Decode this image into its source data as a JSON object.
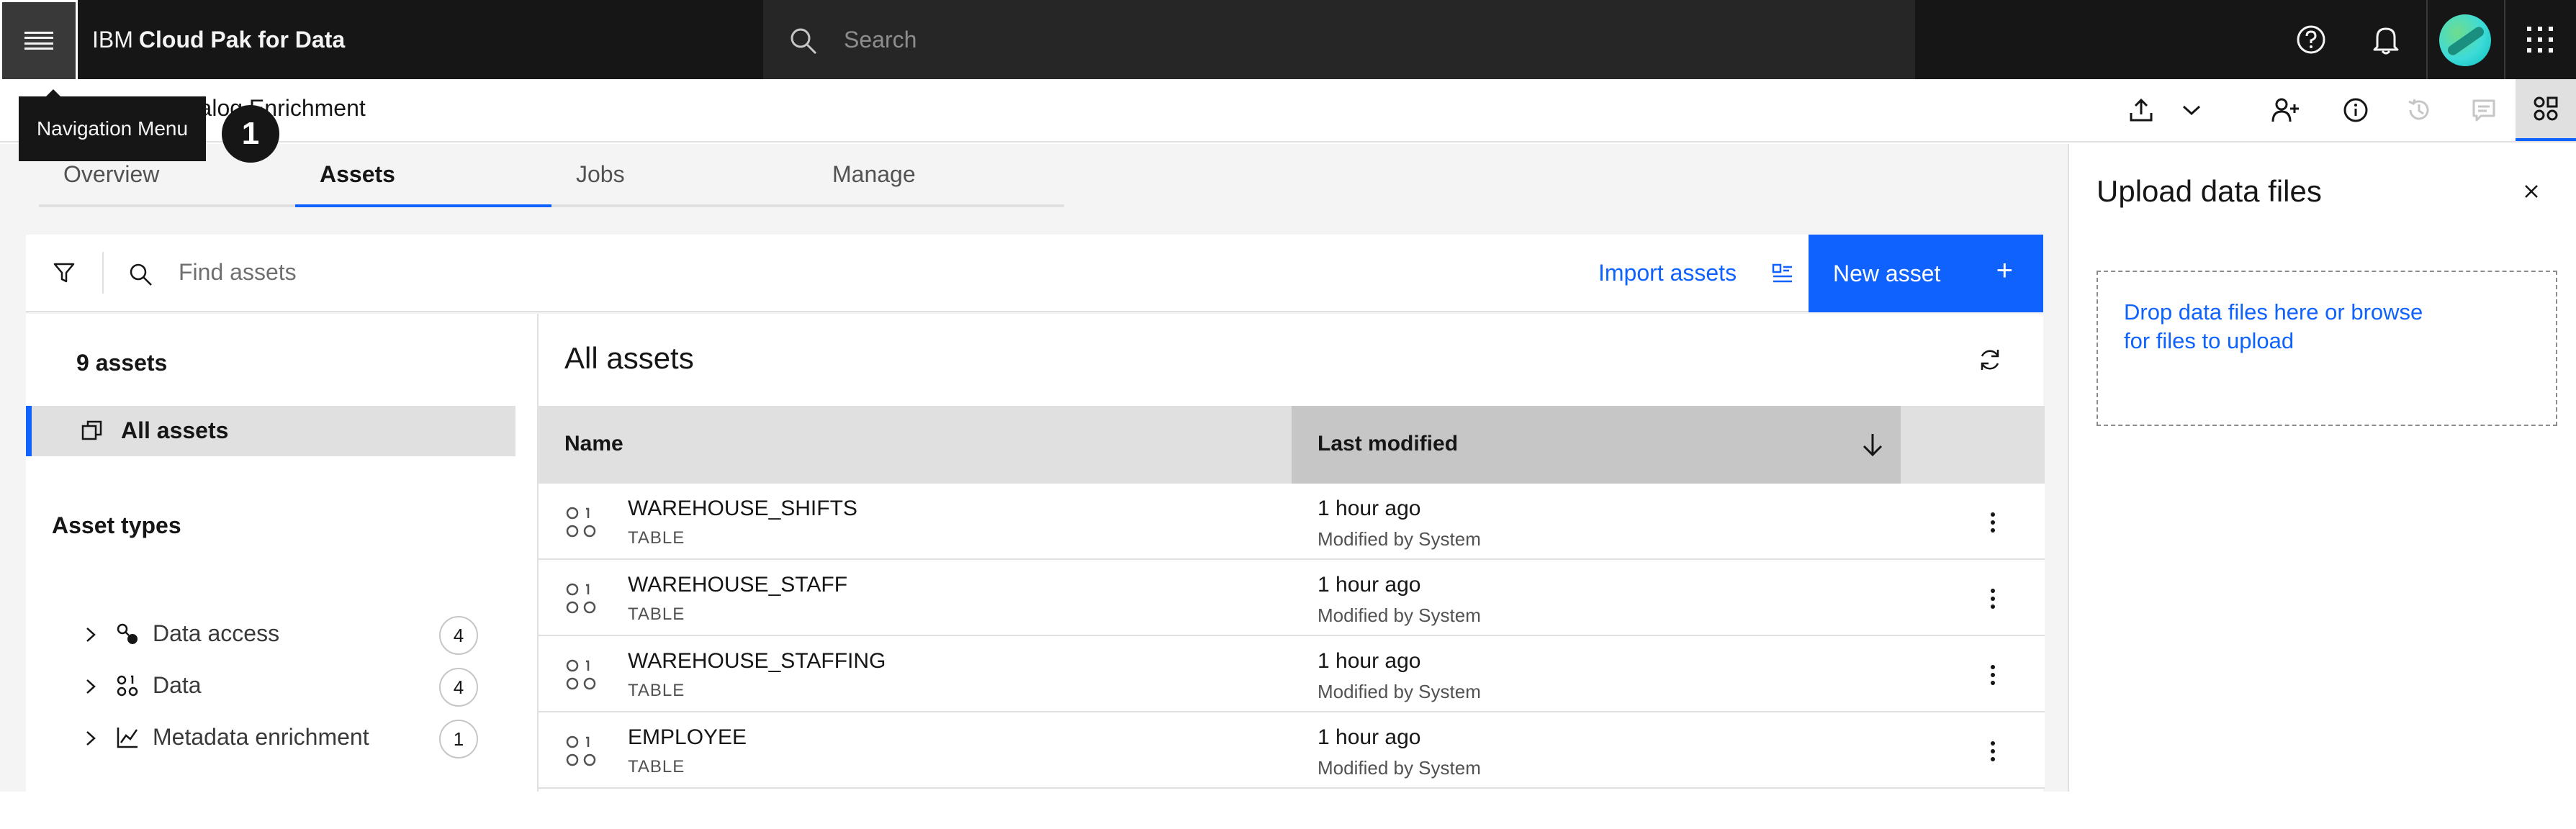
{
  "header": {
    "brand_prefix": "IBM",
    "brand_name": "Cloud Pak for Data",
    "search_placeholder": "Search",
    "icons": [
      "menu-icon",
      "search-icon",
      "help-icon",
      "notification-icon",
      "avatar",
      "app-switcher-icon"
    ]
  },
  "tooltip": {
    "text": "Navigation Menu"
  },
  "annotation_badge": {
    "text": "1"
  },
  "project": {
    "title": "Business Catalog Enrichment",
    "actions": [
      "upload-icon",
      "chevron-down-icon",
      "add-collaborator-icon",
      "info-icon",
      "history-icon",
      "comment-icon",
      "data-assets-icon"
    ]
  },
  "tabs": [
    {
      "label": "Overview",
      "active": false
    },
    {
      "label": "Assets",
      "active": true
    },
    {
      "label": "Jobs",
      "active": false
    },
    {
      "label": "Manage",
      "active": false
    }
  ],
  "toolbar": {
    "find_placeholder": "Find assets",
    "import_label": "Import assets",
    "new_asset_label": "New asset",
    "new_asset_plus": "+"
  },
  "sidebar": {
    "asset_count": "9 assets",
    "all_assets_label": "All assets",
    "asset_types_title": "Asset types",
    "types": [
      {
        "label": "Data access",
        "count": "4",
        "icon": "data-access-icon"
      },
      {
        "label": "Data",
        "count": "4",
        "icon": "data-icon"
      },
      {
        "label": "Metadata enrichment",
        "count": "1",
        "icon": "metadata-enrichment-icon"
      }
    ]
  },
  "assets_table": {
    "title": "All assets",
    "columns": {
      "name": "Name",
      "modified": "Last modified"
    },
    "rows": [
      {
        "name": "WAREHOUSE_SHIFTS",
        "type": "TABLE",
        "modified": "1 hour ago",
        "modified_by": "Modified by System"
      },
      {
        "name": "WAREHOUSE_STAFF",
        "type": "TABLE",
        "modified": "1 hour ago",
        "modified_by": "Modified by System"
      },
      {
        "name": "WAREHOUSE_STAFFING",
        "type": "TABLE",
        "modified": "1 hour ago",
        "modified_by": "Modified by System"
      },
      {
        "name": "EMPLOYEE",
        "type": "TABLE",
        "modified": "1 hour ago",
        "modified_by": "Modified by System"
      }
    ]
  },
  "upload_panel": {
    "title": "Upload data files",
    "drop_text": "Drop data files here or browse for files to upload"
  },
  "colors": {
    "accent": "#0f62fe",
    "header_bg": "#161616",
    "page_bg": "#f4f4f4"
  }
}
